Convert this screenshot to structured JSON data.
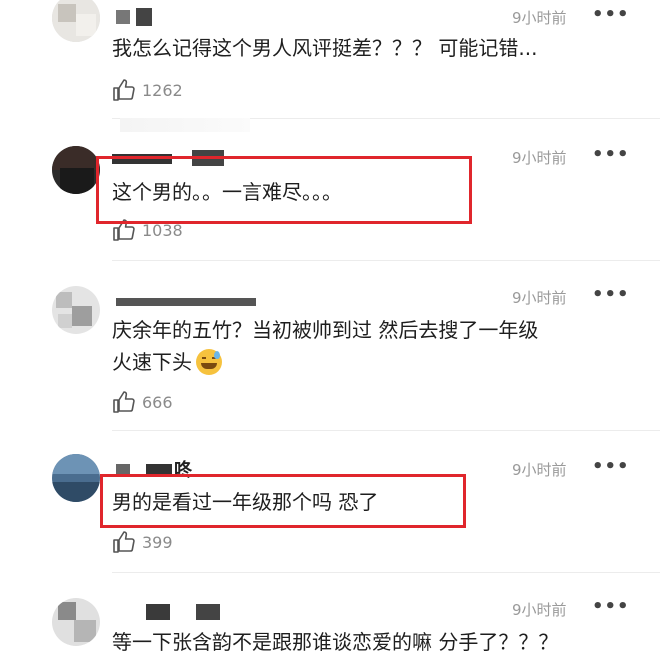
{
  "comments": [
    {
      "time": "9小时前",
      "text": "我怎么记得这个男人风评挺差？？？ 可能记错...",
      "likes": "1262"
    },
    {
      "time": "9小时前",
      "text": "这个男的。。一言难尽。。。",
      "likes": "1038",
      "highlighted": true
    },
    {
      "time": "9小时前",
      "text": "庆余年的五竹？当初被帅到过 然后去搜了一年级",
      "text_line2": "火速下头",
      "likes": "666"
    },
    {
      "time": "9小时前",
      "name_partial": "咚",
      "text": "男的是看过一年级那个吗 恐了",
      "likes": "399",
      "highlighted": true
    },
    {
      "time": "9小时前",
      "text": "等一下张含韵不是跟那谁谈恋爱的嘛 分手了？？？"
    }
  ],
  "more_label": "•••",
  "icons": {
    "like": "thumbs-up-icon",
    "more": "more-dots-icon",
    "emoji": "grinning-sweat-emoji-icon"
  },
  "colors": {
    "highlight": "#e0262c",
    "time": "#9a9a9a",
    "likes": "#8a8a8a"
  }
}
